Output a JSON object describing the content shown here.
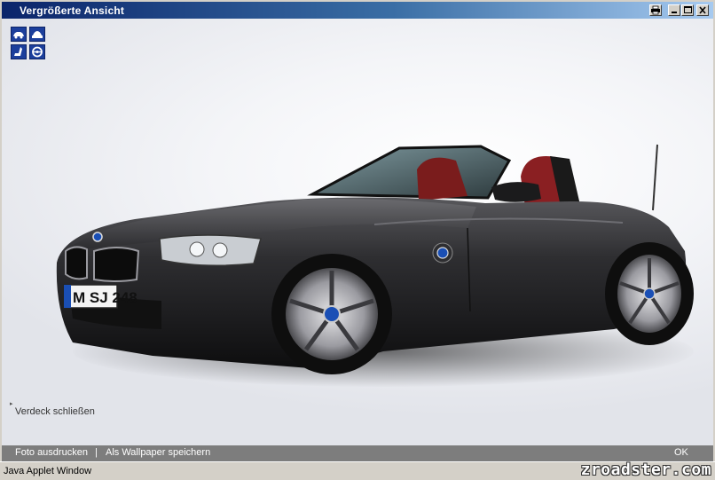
{
  "window": {
    "title": "Vergrößerte Ansicht",
    "buttons": {
      "print_icon": "printer-icon",
      "minimize_icon": "minimize-icon",
      "maximize_icon": "maximize-icon",
      "close_icon": "close-icon"
    }
  },
  "view_selector": {
    "items": [
      {
        "icon": "car-front-view-icon"
      },
      {
        "icon": "car-side-view-icon"
      },
      {
        "icon": "car-interior-seat-icon"
      },
      {
        "icon": "steering-wheel-icon"
      }
    ]
  },
  "image": {
    "license_plate": "M SJ 248",
    "hood_toggle_label": "Verdeck schließen"
  },
  "bottom_bar": {
    "print_label": "Foto ausdrucken",
    "separator": "|",
    "wallpaper_label": "Als Wallpaper speichern",
    "ok_label": "OK"
  },
  "status_bar": {
    "text": "Java Applet Window"
  },
  "watermark": "zroadster.com",
  "colors": {
    "titlebar_start": "#0a246a",
    "titlebar_end": "#a6caf0",
    "icon_blue": "#1c3f9c",
    "bottom_bar": "#7d7d7d",
    "car_body": "#2a2a2c"
  }
}
